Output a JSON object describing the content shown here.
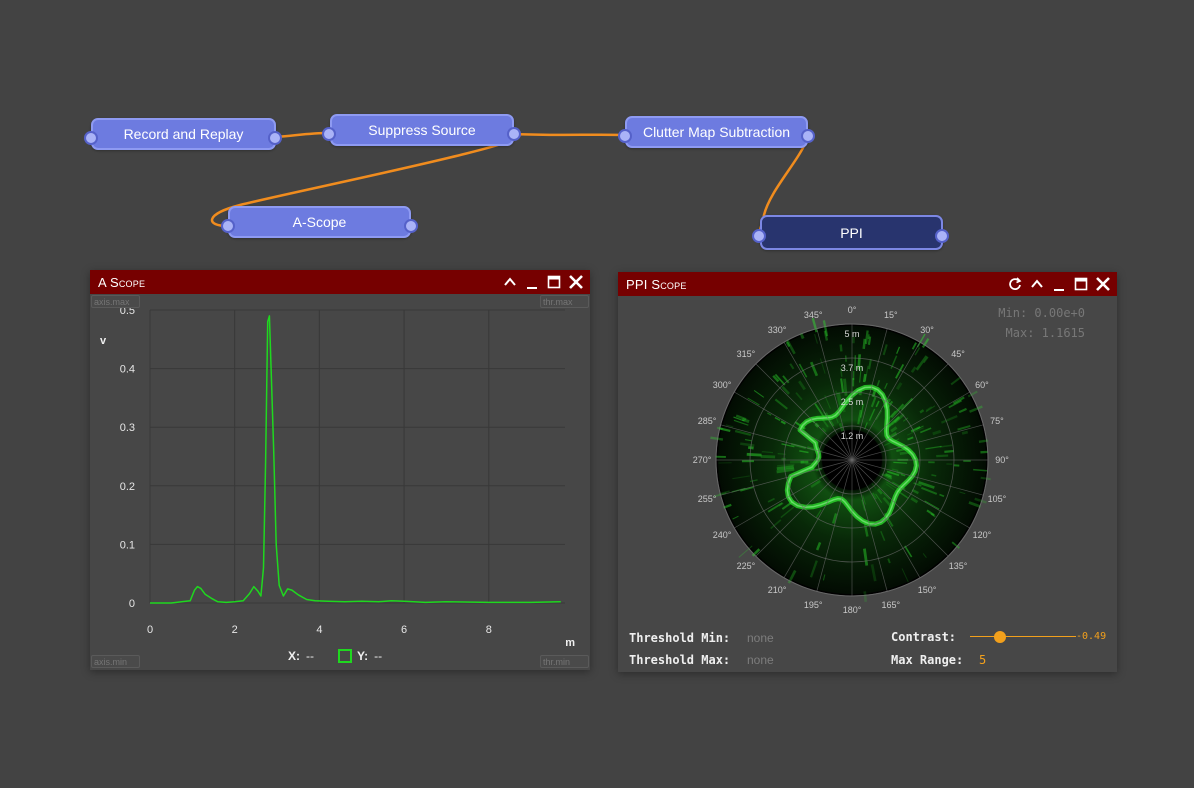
{
  "graph": {
    "nodes": [
      {
        "label": "Record and Replay"
      },
      {
        "label": "Suppress Source"
      },
      {
        "label": "Clutter Map Subtraction"
      },
      {
        "label": "A-Scope"
      },
      {
        "label": "PPI"
      }
    ],
    "connection_color": "#f08c1e"
  },
  "ascope": {
    "title": "A Scope",
    "axis_max_placeholder": "axis.max",
    "axis_min_placeholder": "axis.min",
    "thr_max_placeholder": "thr.max",
    "thr_min_placeholder": "thr.min",
    "readout": {
      "x_label": "X:",
      "x_value": "--",
      "y_label": "Y:",
      "y_value": "--"
    }
  },
  "chart_data": {
    "type": "line",
    "title": "",
    "xlabel": "m",
    "ylabel": "v",
    "xlim": [
      0,
      9.8
    ],
    "ylim": [
      0,
      0.5
    ],
    "x_ticks": [
      "0",
      "2",
      "4",
      "6",
      "8"
    ],
    "y_ticks": [
      "0",
      "0.1",
      "0.2",
      "0.3",
      "0.4",
      "0.5"
    ],
    "grid": true,
    "series": [
      {
        "color": "#1fd81f",
        "x": [
          0,
          0.5,
          0.95,
          1.05,
          1.12,
          1.2,
          1.3,
          1.45,
          1.6,
          1.8,
          2.0,
          2.2,
          2.35,
          2.45,
          2.55,
          2.62,
          2.68,
          2.73,
          2.78,
          2.82,
          2.86,
          2.92,
          2.98,
          3.05,
          3.15,
          3.25,
          3.35,
          3.5,
          3.7,
          3.9,
          4.2,
          4.6,
          5.0,
          5.4,
          5.7,
          6.0,
          6.5,
          7.0,
          8.0,
          9.0,
          9.7
        ],
        "y": [
          0,
          0,
          0.004,
          0.022,
          0.028,
          0.025,
          0.015,
          0.008,
          0.002,
          0.001,
          0.002,
          0.004,
          0.016,
          0.028,
          0.02,
          0.012,
          0.06,
          0.24,
          0.48,
          0.49,
          0.4,
          0.26,
          0.1,
          0.03,
          0.012,
          0.024,
          0.022,
          0.014,
          0.006,
          0.004,
          0.003,
          0.002,
          0.003,
          0.002,
          0.004,
          0.003,
          0.001,
          0.002,
          0.001,
          0.001,
          0.002
        ]
      }
    ]
  },
  "ppi": {
    "title": "PPI Scope",
    "min_text": "Min: 0.00e+0",
    "max_text": "Max: 1.1615",
    "angle_labels": [
      "0°",
      "15°",
      "30°",
      "45°",
      "60°",
      "75°",
      "90°",
      "105°",
      "120°",
      "135°",
      "150°",
      "165°",
      "180°",
      "195°",
      "210°",
      "225°",
      "240°",
      "255°",
      "270°",
      "285°",
      "300°",
      "315°",
      "330°",
      "345°"
    ],
    "range_labels": [
      "5 m",
      "3.7 m",
      "2.5 m",
      "1.2 m"
    ],
    "controls": {
      "threshold_min_label": "Threshold Min:",
      "threshold_min_value": "none",
      "threshold_max_label": "Threshold Max:",
      "threshold_max_value": "none",
      "contrast_label": "Contrast:",
      "contrast_value": "-0.49",
      "max_range_label": "Max Range:",
      "max_range_value": "5"
    },
    "accent": "#f2a01c",
    "echo_color": "#2ee02e"
  }
}
